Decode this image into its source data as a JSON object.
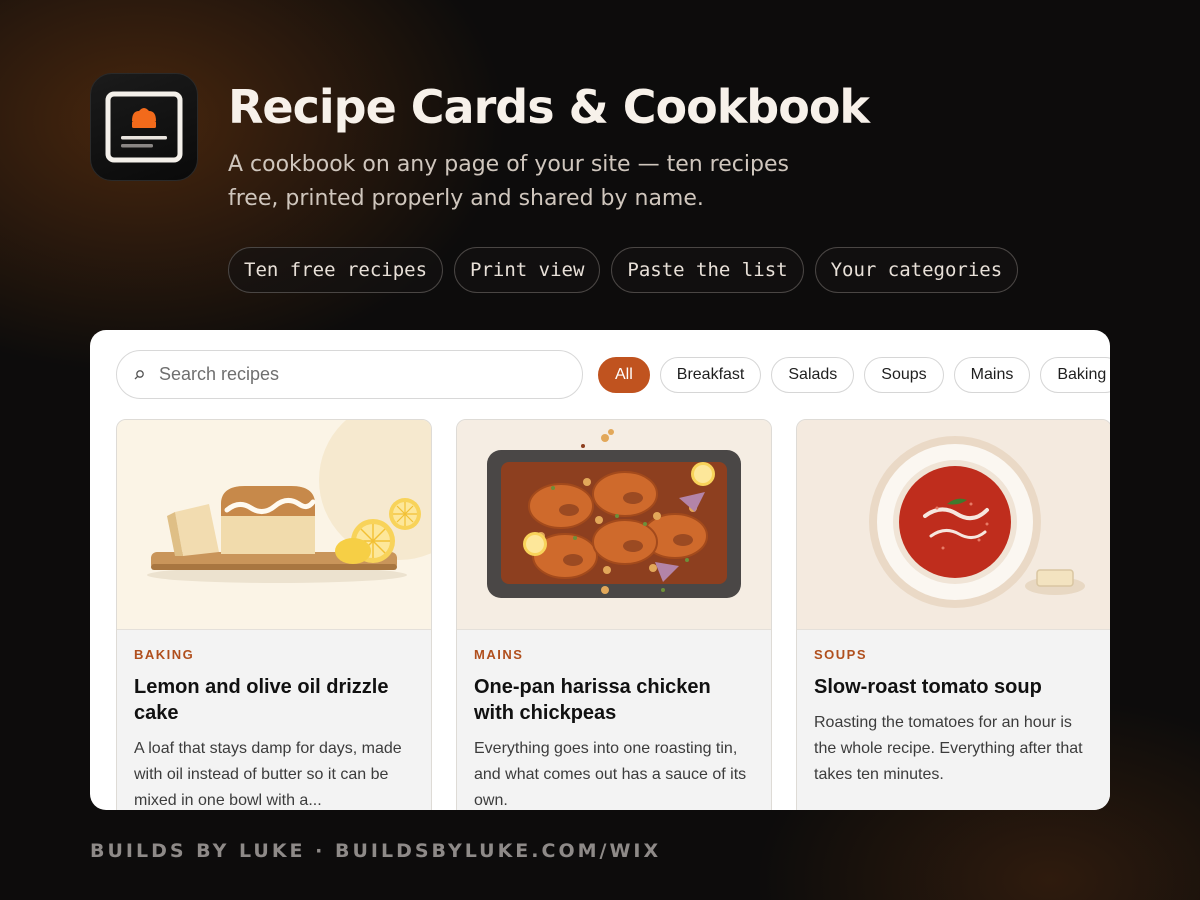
{
  "app": {
    "icon": "recipe-card-icon",
    "title": "Recipe Cards & Cookbook",
    "subtitle": "A cookbook on any page of your site — ten recipes free, printed properly and shared by name."
  },
  "features": [
    "Ten free recipes",
    "Print view",
    "Paste the list",
    "Your categories"
  ],
  "search": {
    "icon": "search-icon",
    "placeholder": "Search recipes",
    "value": ""
  },
  "categories": {
    "selected": "All",
    "items": [
      "All",
      "Breakfast",
      "Salads",
      "Soups",
      "Mains",
      "Baking"
    ]
  },
  "recipes": [
    {
      "image": "lemon-drizzle-cake-illustration",
      "category": "BAKING",
      "title": "Lemon and olive oil drizzle cake",
      "description": "A loaf that stays damp for days, made with oil instead of butter so it can be mixed in one bowl with a..."
    },
    {
      "image": "harissa-chicken-tray-illustration",
      "category": "MAINS",
      "title": "One-pan harissa chicken with chickpeas",
      "description": "Everything goes into one roasting tin, and what comes out has a sauce of its own."
    },
    {
      "image": "tomato-soup-bowl-illustration",
      "category": "SOUPS",
      "title": "Slow-roast tomato soup",
      "description": "Roasting the tomatoes for an hour is the whole recipe. Everything after that takes ten minutes."
    }
  ],
  "footer": {
    "text": "BUILDS BY LUKE · BUILDSBYLUKE.COM/WIX"
  },
  "colors": {
    "accent": "#c0531f",
    "background": "#0d0c0c",
    "panel": "#ffffff"
  }
}
